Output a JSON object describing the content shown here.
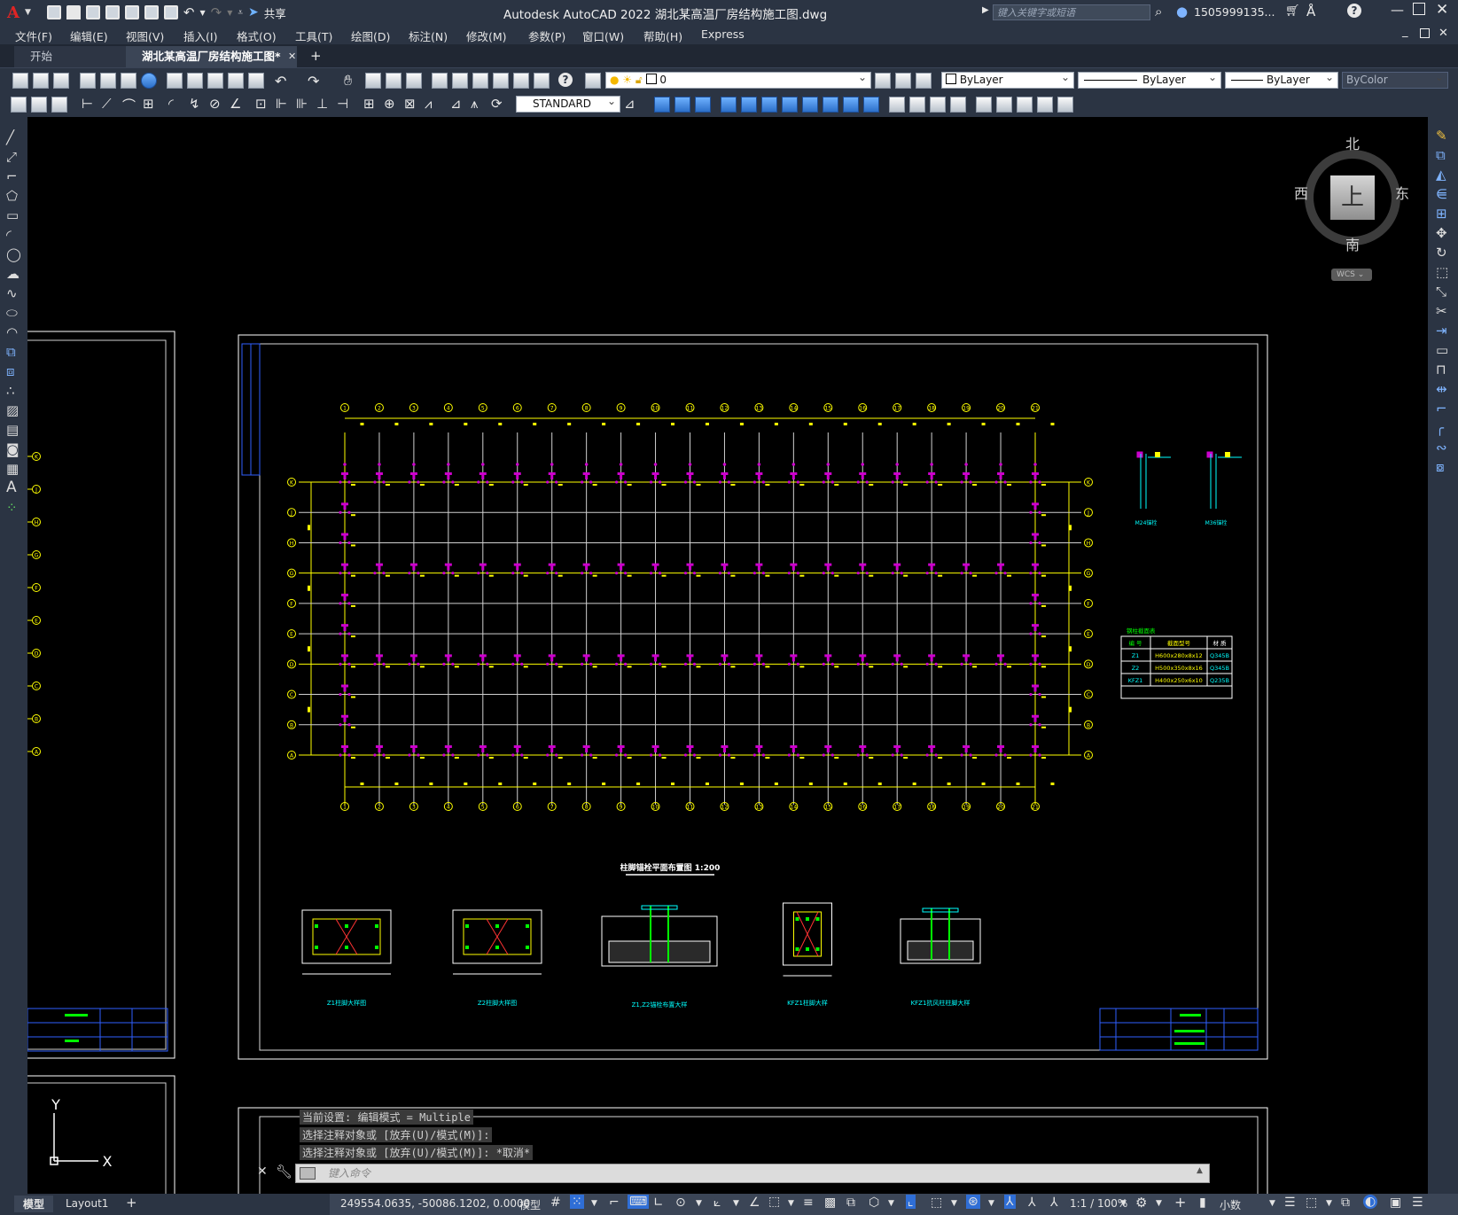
{
  "app": {
    "logo": "A",
    "share_label": "共享",
    "title": "Autodesk AutoCAD 2022    湖北某高温厂房结构施工图.dwg",
    "search_placeholder": "键入关键字或短语",
    "user": "1505999135..."
  },
  "menu": [
    "文件(F)",
    "编辑(E)",
    "视图(V)",
    "插入(I)",
    "格式(O)",
    "工具(T)",
    "绘图(D)",
    "标注(N)",
    "修改(M)",
    "参数(P)",
    "窗口(W)",
    "帮助(H)",
    "Express"
  ],
  "tabs": {
    "start": "开始",
    "active": "湖北某高温厂房结构施工图*",
    "add": "+"
  },
  "toolbar": {
    "layer_value": "0",
    "color_value": "ByLayer",
    "linetype_value": "ByLayer",
    "lineweight_value": "ByLayer",
    "plotstyle_value": "ByColor",
    "textstyle_value": "STANDARD"
  },
  "viewcube": {
    "north": "北",
    "south": "南",
    "east": "东",
    "west": "西",
    "top": "上",
    "wcs": "WCS"
  },
  "drawing": {
    "plan_title": "柱脚锚栓平面布置图 1:200",
    "grid_numbers": [
      "1",
      "2",
      "3",
      "4",
      "5",
      "6",
      "7",
      "8",
      "9",
      "10",
      "11",
      "12",
      "13",
      "14",
      "15",
      "16",
      "17",
      "18",
      "19",
      "20",
      "21"
    ],
    "grid_letters": [
      "K",
      "J",
      "H",
      "G",
      "F",
      "E",
      "D",
      "C",
      "B",
      "A"
    ],
    "table": {
      "title": "钢柱截面表",
      "headers": [
        "编 号",
        "截面型号",
        "材 质"
      ],
      "rows": [
        [
          "Z1",
          "H600x280x8x12",
          "Q345B"
        ],
        [
          "Z2",
          "H500x350x8x16",
          "Q345B"
        ],
        [
          "KFZ1",
          "H400x250x6x10",
          "Q235B"
        ]
      ]
    },
    "details": [
      "Z1柱脚大样图",
      "Z2柱脚大样图",
      "Z1,Z2锚栓布置大样",
      "KFZ1柱脚大样",
      "KFZ1抗风柱柱脚大样"
    ],
    "anchor_details": [
      "M24锚栓",
      "M36锚栓"
    ],
    "ucs_y": "Y",
    "ucs_x": "X"
  },
  "command": {
    "line1": "当前设置: 编辑模式 = Multiple",
    "line2": "选择注释对象或 [放弃(U)/模式(M)]:",
    "line3": "选择注释对象或 [放弃(U)/模式(M)]: *取消*",
    "input_placeholder": "键入命令"
  },
  "layout_tabs": [
    "模型",
    "Layout1",
    "+"
  ],
  "status": {
    "coords": "249554.0635, -50086.1202, 0.0000",
    "space": "模型",
    "scale": "1:1 / 100%",
    "units": "小数"
  },
  "colors": {
    "chrome": "#2b3443",
    "canvas": "#000000",
    "grid_line": "#ffff00",
    "column_marker": "#cc00cc",
    "detail_cyan": "#00ffff"
  }
}
